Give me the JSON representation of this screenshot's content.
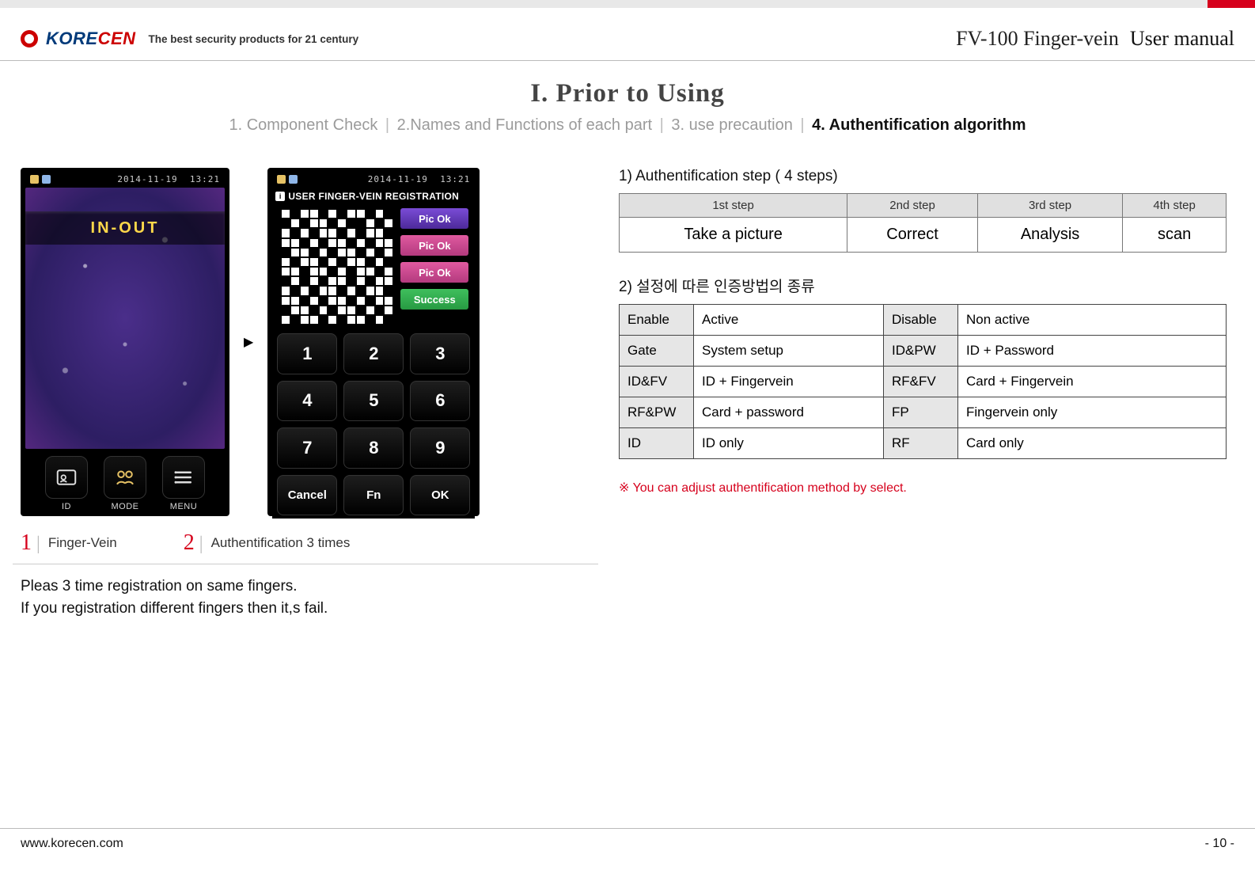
{
  "header": {
    "brand_logo_1": "KORE",
    "brand_logo_2": "CEN",
    "tagline": "The best security products for 21 century",
    "product": "FV-100 Finger-vein",
    "doc_type": "User manual"
  },
  "title": "I. Prior to Using",
  "breadcrumb": {
    "items": [
      "1. Component Check",
      "2.Names and Functions of each part",
      "3. use precaution",
      "4. Authentification algorithm"
    ],
    "active_index": 3
  },
  "phone1": {
    "date": "2014-11-19",
    "time": "13:21",
    "inout": "IN-OUT",
    "buttons": [
      "ID",
      "MODE",
      "MENU"
    ]
  },
  "phone2": {
    "date": "2014-11-19",
    "time": "13:21",
    "reg_title": "USER FINGER-VEIN REGISTRATION",
    "pills": [
      "Pic Ok",
      "Pic Ok",
      "Pic Ok",
      "Success"
    ],
    "keys": [
      "1",
      "2",
      "3",
      "4",
      "5",
      "6",
      "7",
      "8",
      "9",
      "<",
      ">",
      "Cancel",
      "Fn",
      "OK"
    ],
    "keypad_small": [
      "Cancel",
      "Fn",
      "OK"
    ]
  },
  "captions": {
    "c1_num": "1",
    "c1_text": "Finger-Vein",
    "c2_num": "2",
    "c2_text": "Authentification 3 times"
  },
  "note_line1": "Pleas 3 time registration on same fingers.",
  "note_line2": "If you registration different fingers then it,s fail.",
  "right": {
    "sec1_title": "1) Authentification step ( 4 steps)",
    "steps_headers": [
      "1st step",
      "2nd step",
      "3rd step",
      "4th step"
    ],
    "steps_values": [
      "Take a picture",
      "Correct",
      "Analysis",
      "scan"
    ],
    "sec2_title": "2) 설정에 따른 인증방법의 종류",
    "defs": [
      {
        "k1": "Enable",
        "v1": "Active",
        "k2": "Disable",
        "v2": "Non active"
      },
      {
        "k1": "Gate",
        "v1": "System setup",
        "k2": "ID&PW",
        "v2": "ID + Password"
      },
      {
        "k1": "ID&FV",
        "v1": "ID + Fingervein",
        "k2": "RF&FV",
        "v2": "Card + Fingervein"
      },
      {
        "k1": "RF&PW",
        "v1": "Card + password",
        "k2": "FP",
        "v2": "Fingervein only"
      },
      {
        "k1": "ID",
        "v1": "ID only",
        "k2": "RF",
        "v2": "Card only"
      }
    ],
    "warning": "※ You can  adjust authentification method by select."
  },
  "footer": {
    "url": "www.korecen.com",
    "page": "- 10 -"
  }
}
